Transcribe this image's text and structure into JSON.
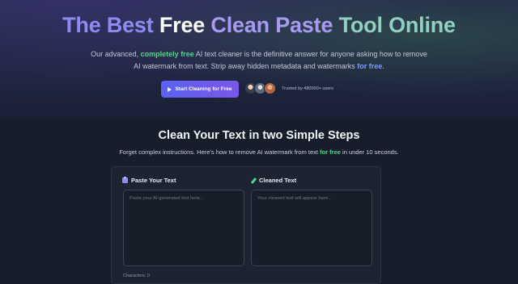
{
  "hero": {
    "title_parts": [
      "The Best",
      "Free",
      "Clean Paste Tool Online"
    ],
    "title_clean": "Clean Paste",
    "title_tool": "Tool Online",
    "desc_1": "Our advanced,",
    "desc_highlight_1": "completely free",
    "desc_2": "AI text cleaner is the definitive answer for anyone asking how to remove AI watermark from text. Strip away hidden metadata and watermarks",
    "desc_highlight_2": "for free",
    "desc_3": ".",
    "cta_label": "Start Cleaning for Free",
    "trusted_text": "Trusted by 480000+ users"
  },
  "steps": {
    "title": "Clean Your Text in two Simple Steps",
    "desc_1": "Forget complex instructions. Here's how to remove AI watermark from text",
    "desc_highlight": "for free",
    "desc_2": "in under 10 seconds."
  },
  "editor": {
    "paste_label": "Paste Your Text",
    "paste_placeholder": "Paste your AI-generated text here...",
    "cleaned_label": "Cleaned Text",
    "cleaned_placeholder": "Your cleaned text will appear here...",
    "characters_label": "Characters: 0"
  },
  "colors": {
    "accent_purple": "#8e8cf2",
    "accent_green": "#4fd88a",
    "cta_gradient_start": "#5a63f2",
    "cta_gradient_end": "#7b56e6"
  },
  "icons": [
    "play-icon",
    "clipboard-icon",
    "pencil-icon"
  ]
}
